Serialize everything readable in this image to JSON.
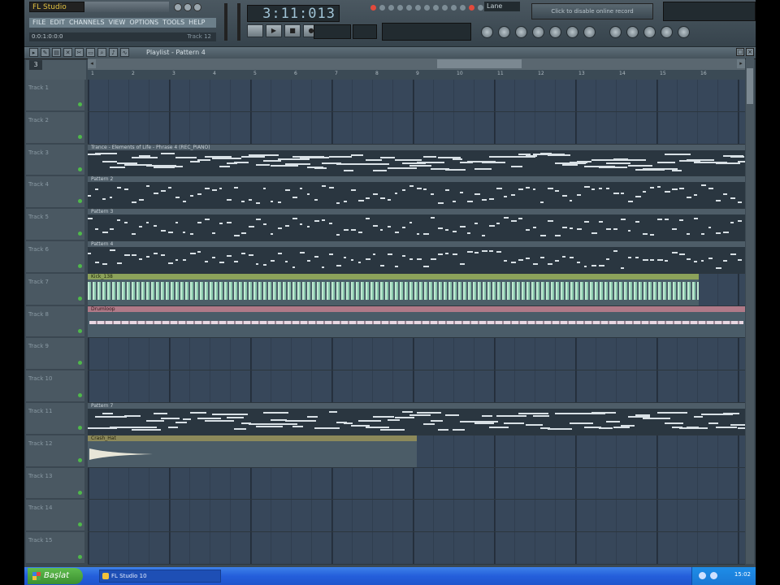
{
  "app": {
    "logo_text": "FL Studio",
    "menu": [
      "FILE",
      "EDIT",
      "CHANNELS",
      "VIEW",
      "OPTIONS",
      "TOOLS",
      "HELP"
    ],
    "hint_left": "0:0:1:0:0:0",
    "hint_right": "Track 12",
    "time_display": "3:11:013",
    "user_field": "Lane",
    "hint_field": "Click to disable online record",
    "transport": {
      "play": "▶",
      "stop": "■",
      "record": "●"
    },
    "accent_color": "#e24a3c"
  },
  "playlist": {
    "title": "Playlist - Pattern 4",
    "pattern_number": "3",
    "ruler": [
      "1",
      "2",
      "3",
      "4",
      "5",
      "6",
      "7",
      "8",
      "9",
      "10",
      "11",
      "12",
      "13",
      "14",
      "15",
      "16"
    ]
  },
  "tracks": [
    {
      "name": "Track 1"
    },
    {
      "name": "Track 2"
    },
    {
      "name": "Track 3",
      "clip": {
        "type": "pattern",
        "label": "Trance - Elements of Life - Phrase 4 (REC_PIANO)",
        "start": 0,
        "end": 1
      }
    },
    {
      "name": "Track 4",
      "clip": {
        "type": "pattern",
        "label": "Pattern 2",
        "start": 0,
        "end": 1
      }
    },
    {
      "name": "Track 5",
      "clip": {
        "type": "pattern",
        "label": "Pattern 3",
        "start": 0,
        "end": 1
      }
    },
    {
      "name": "Track 6",
      "clip": {
        "type": "pattern",
        "label": "Pattern 4",
        "start": 0,
        "end": 1
      }
    },
    {
      "name": "Track 7",
      "clip": {
        "type": "audio-green",
        "label": "Kick_138",
        "start": 0,
        "end": 0.93
      }
    },
    {
      "name": "Track 8",
      "clip": {
        "type": "audio-pink",
        "label": "Drumloop",
        "start": 0,
        "end": 1
      }
    },
    {
      "name": "Track 9"
    },
    {
      "name": "Track 10"
    },
    {
      "name": "Track 11",
      "clip": {
        "type": "pattern",
        "label": "Pattern 7",
        "start": 0,
        "end": 1
      }
    },
    {
      "name": "Track 12",
      "clip": {
        "type": "audio-olive",
        "label": "Crash_Hat",
        "start": 0,
        "end": 0.5
      }
    },
    {
      "name": "Track 13"
    },
    {
      "name": "Track 14"
    },
    {
      "name": "Track 15"
    }
  ],
  "taskbar": {
    "start_label": "Başlat",
    "task_label": "FL Studio 10",
    "clock": "15:02"
  }
}
